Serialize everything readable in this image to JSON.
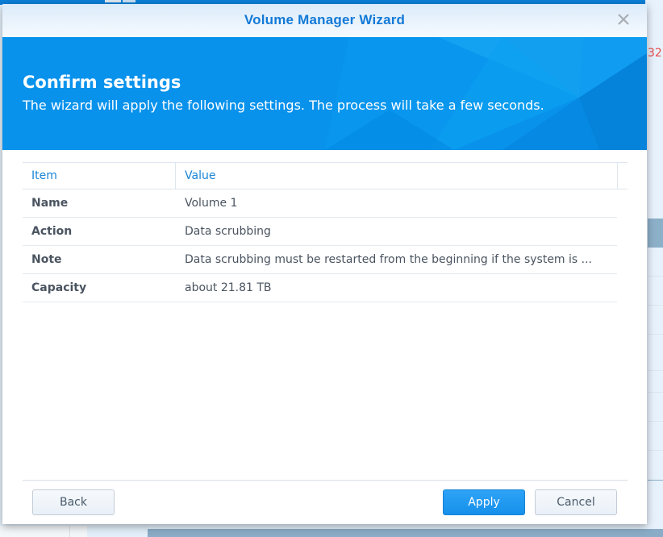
{
  "background": {
    "partial_text": "32"
  },
  "dialog": {
    "title": "Volume Manager Wizard",
    "close_icon": "close-icon",
    "banner": {
      "title": "Confirm settings",
      "subtitle": "The wizard will apply the following settings. The process will take a few seconds."
    },
    "grid": {
      "columns": [
        "Item",
        "Value"
      ],
      "rows": [
        {
          "item": "Name",
          "value": "Volume 1"
        },
        {
          "item": "Action",
          "value": "Data scrubbing"
        },
        {
          "item": "Note",
          "value": "Data scrubbing must be restarted from the beginning if the system is ..."
        },
        {
          "item": "Capacity",
          "value": "about 21.81 TB"
        }
      ]
    },
    "buttons": {
      "back": "Back",
      "apply": "Apply",
      "cancel": "Cancel"
    }
  },
  "colors": {
    "accent": "#1279d6",
    "banner": "#0892ec",
    "primary_button": "#1590ea"
  }
}
